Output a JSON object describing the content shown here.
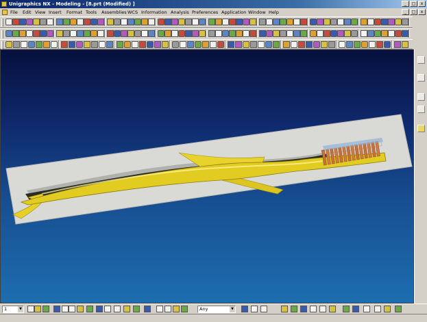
{
  "window": {
    "title": "Unigraphics NX - Modeling - [8.prt (Modified) ]",
    "buttons": [
      "_",
      "□",
      "x"
    ]
  },
  "menu": [
    "File",
    "Edit",
    "View",
    "Insert",
    "Format",
    "Tools",
    "Assemblies",
    "WCS",
    "Information",
    "Analysis",
    "Preferences",
    "Application",
    "Window",
    "Help"
  ],
  "mdi_buttons": [
    "_",
    "□",
    "x"
  ],
  "status": {
    "layer": "1",
    "filter": "Any"
  },
  "colors": {
    "title_start": "#0a246a",
    "viewport_top": "#07103d",
    "viewport_bottom": "#1d6eb0",
    "handle": "#e0c820",
    "bristles": "#c8703a"
  }
}
